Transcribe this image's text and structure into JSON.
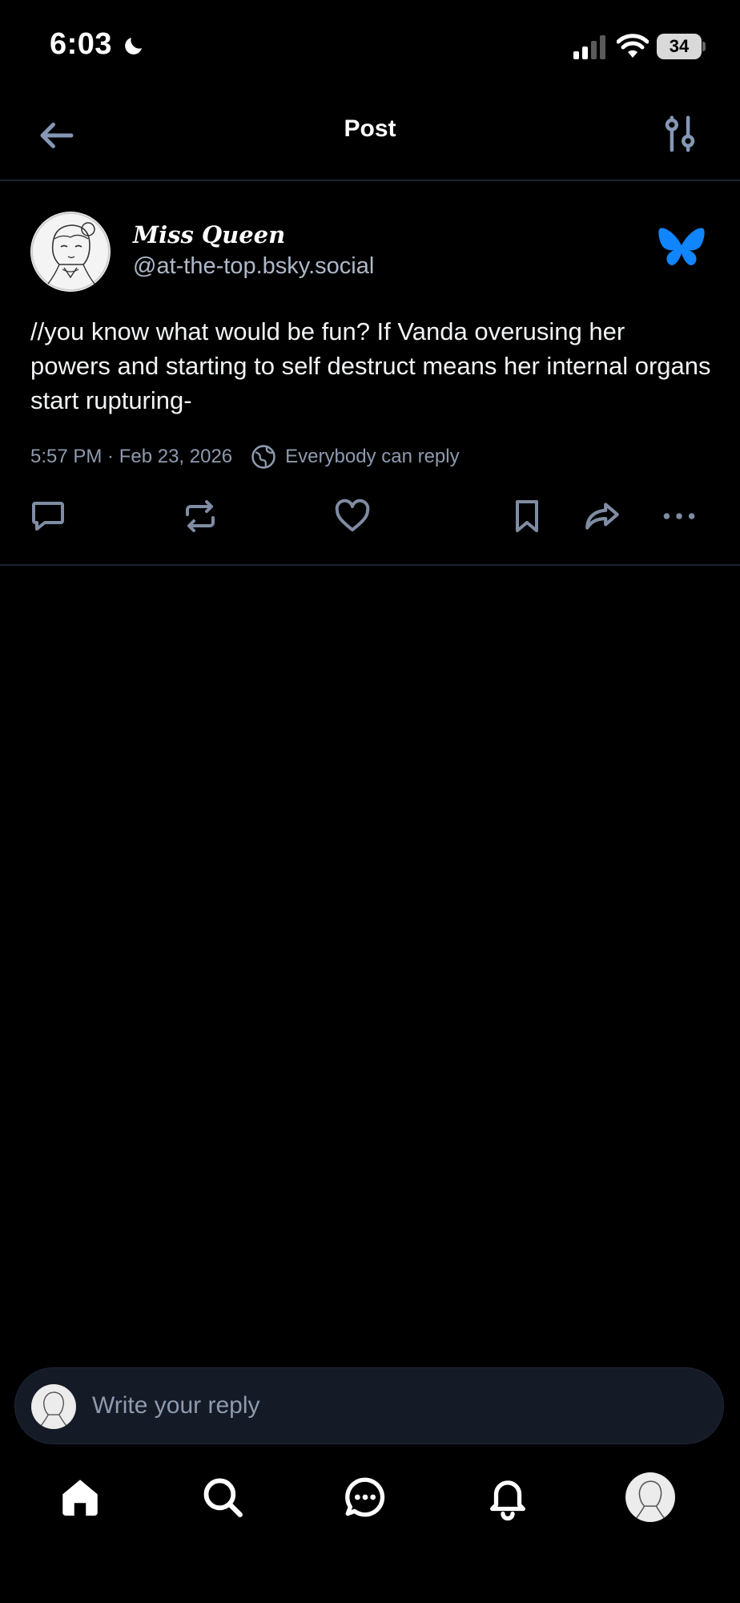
{
  "status_bar": {
    "time": "6:03",
    "battery": "34",
    "icons": [
      "moon-icon",
      "signal-icon",
      "wifi-icon",
      "battery-icon"
    ]
  },
  "header": {
    "title": "Post",
    "back_icon": "arrow-left-icon",
    "filter_icon": "sliders-icon"
  },
  "post": {
    "author_name": "Miss Queen",
    "author_handle": "@at-the-top.bsky.social",
    "text": "//you know what would be fun? If Vanda overusing her powers and starting to self destruct means her internal organs start rupturing-",
    "timestamp": "5:57 PM · Feb 23, 2026",
    "reply_setting": "Everybody can reply",
    "actions": [
      "reply-icon",
      "repost-icon",
      "like-icon",
      "bookmark-icon",
      "share-icon",
      "more-icon"
    ]
  },
  "reply_bar": {
    "placeholder": "Write your reply"
  },
  "tabbar": {
    "items": [
      "home-icon",
      "search-icon",
      "chat-icon",
      "notifications-icon",
      "profile-avatar"
    ]
  },
  "colors": {
    "background": "#000000",
    "accent": "#1185fe",
    "muted_text": "#8e9aae",
    "icon_muted": "#7f8ca3",
    "divider": "#1c2230",
    "reply_bar_bg": "#141a26"
  }
}
